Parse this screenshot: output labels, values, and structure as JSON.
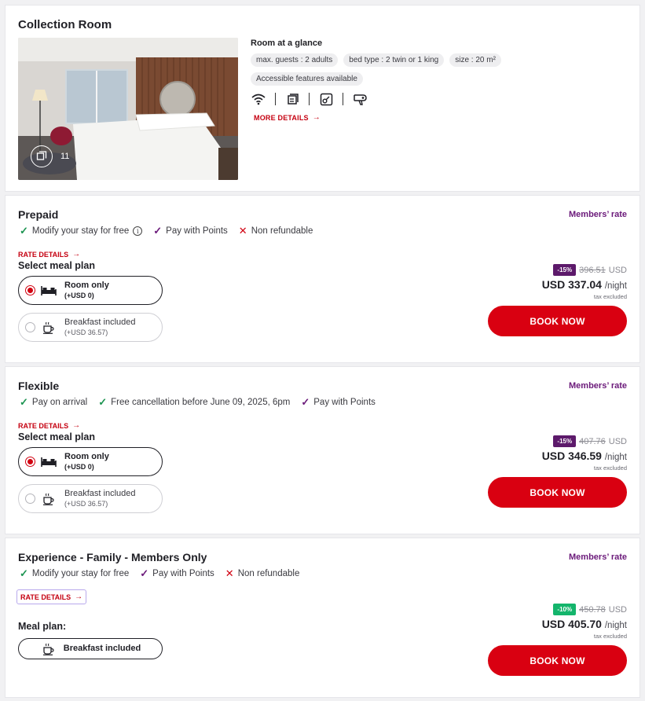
{
  "room": {
    "title": "Collection Room",
    "photo_count": "11",
    "glance_title": "Room at a glance",
    "pills": [
      "max. guests :   2 adults",
      "bed type :   2 twin or 1 king",
      "size :   20 m²"
    ],
    "accessible": "Accessible features available",
    "amenity_icons": [
      "wifi-icon",
      "tv-icon",
      "safe-icon",
      "hairdryer-icon"
    ],
    "more_details": "MORE DETAILS"
  },
  "rates": [
    {
      "name": "Prepaid",
      "members": "Members’ rate",
      "features": [
        {
          "icon": "check",
          "text": "Modify your stay for free"
        },
        {
          "icon": "check-purple",
          "text": "Pay with Points"
        },
        {
          "icon": "x",
          "text": "Non refundable"
        }
      ],
      "rate_details": "RATE DETAILS",
      "meal_label": "Select meal plan",
      "meals": [
        {
          "title": "Room only",
          "price": "(+USD 0)",
          "selected": true
        },
        {
          "title": "Breakfast included",
          "price": "(+USD 36.57)",
          "selected": false
        }
      ],
      "discount": "-15%",
      "old_price": "396.51",
      "currency": "USD",
      "price": "USD 337.04",
      "per_night": "/night",
      "tax": "tax excluded",
      "book": "BOOK NOW"
    },
    {
      "name": "Flexible",
      "members": "Members’ rate",
      "features": [
        {
          "icon": "check",
          "text": "Pay on arrival"
        },
        {
          "icon": "check",
          "text": "Free cancellation before June 09, 2025, 6pm"
        },
        {
          "icon": "check-purple",
          "text": "Pay with Points"
        }
      ],
      "rate_details": "RATE DETAILS",
      "meal_label": "Select meal plan",
      "meals": [
        {
          "title": "Room only",
          "price": "(+USD 0)",
          "selected": true
        },
        {
          "title": "Breakfast included",
          "price": "(+USD 36.57)",
          "selected": false
        }
      ],
      "discount": "-15%",
      "old_price": "407.76",
      "currency": "USD",
      "price": "USD 346.59",
      "per_night": "/night",
      "tax": "tax excluded",
      "book": "BOOK NOW"
    },
    {
      "name": "Experience - Family - Members Only",
      "members": "Members’ rate",
      "features": [
        {
          "icon": "check",
          "text": "Modify your stay for free"
        },
        {
          "icon": "check-purple",
          "text": "Pay with Points"
        },
        {
          "icon": "x",
          "text": "Non refundable"
        }
      ],
      "rate_details": "RATE DETAILS",
      "meal_label": "Meal plan:",
      "meals": [
        {
          "title": "Breakfast included"
        }
      ],
      "discount": "-10%",
      "discount_color": "#14b56c",
      "old_price": "450.78",
      "currency": "USD",
      "price": "USD 405.70",
      "per_night": "/night",
      "tax": "tax excluded",
      "book": "BOOK NOW"
    }
  ],
  "colors": {
    "accent_red": "#d90011",
    "members_purple": "#6b1a7a",
    "check_green": "#1c9451",
    "discount_purple": "#5d1a6b"
  }
}
